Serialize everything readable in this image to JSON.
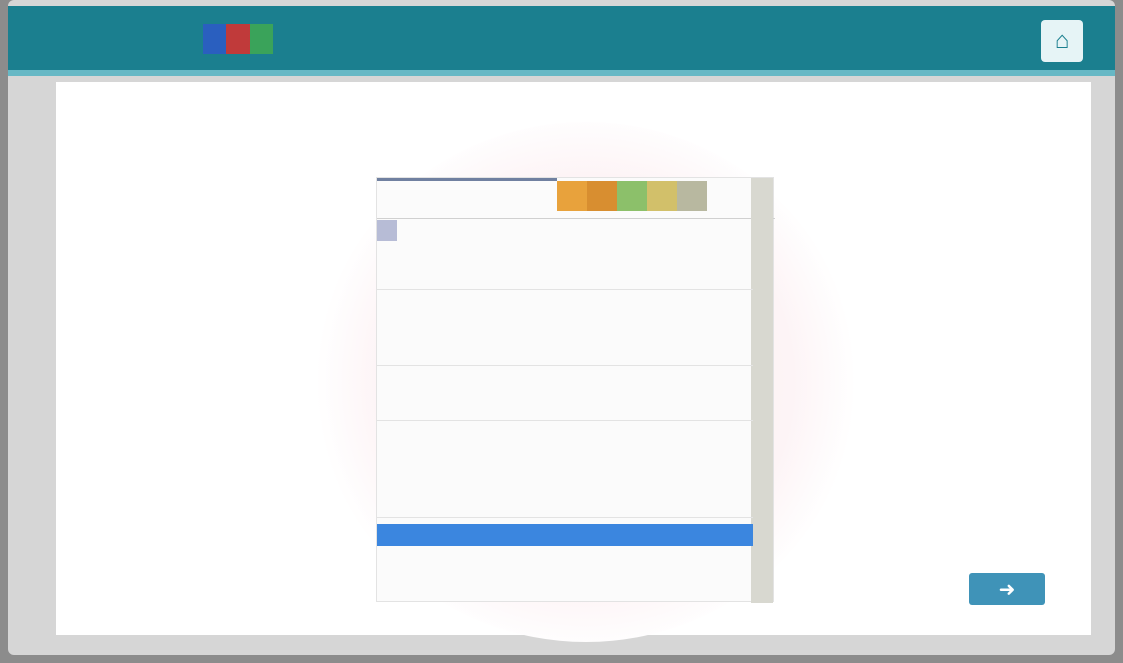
{
  "app": {
    "brand": "",
    "brand_colors": [
      "#2a5fbf",
      "#c03a3a",
      "#3aa35a"
    ],
    "home_icon": "home-icon"
  },
  "content": {
    "subtitle": "",
    "sheet_title": ""
  },
  "sheet": {
    "header_colors": [
      "#e8a23c",
      "#d88e30",
      "#8cc06a",
      "#d2c06a",
      "#b8b8a0"
    ],
    "rows": [
      {
        "label": "",
        "value": "",
        "selected": false
      },
      {
        "label": "",
        "value": "",
        "selected": false
      },
      {
        "label": "",
        "value": "",
        "selected": false
      },
      {
        "label": "",
        "value": "",
        "selected": false
      },
      {
        "label": "",
        "value": "",
        "selected": false
      },
      {
        "label": "",
        "value": "",
        "selected": false
      },
      {
        "label": "",
        "value": "",
        "selected": false
      },
      {
        "label": "",
        "value": "",
        "selected": false
      },
      {
        "label": "",
        "value": "",
        "selected": false
      },
      {
        "label": "",
        "value": "",
        "selected": false
      },
      {
        "label": "",
        "value": "",
        "selected": false
      },
      {
        "label": "",
        "value": "",
        "selected": false
      },
      {
        "label": "",
        "value": "",
        "selected": true
      },
      {
        "label": "",
        "value": "",
        "selected": false
      }
    ]
  },
  "nav": {
    "next_icon": "arrow-right-icon"
  }
}
